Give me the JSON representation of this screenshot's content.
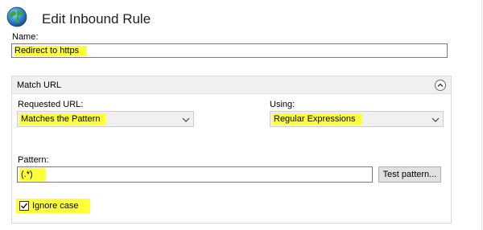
{
  "dialog": {
    "title": "Edit Inbound Rule",
    "icon": "globe-icon"
  },
  "name": {
    "label": "Name:",
    "value": "Redirect to https"
  },
  "match_url": {
    "section_title": "Match URL",
    "collapse_icon": "chevron-up-circle-icon",
    "requested_url": {
      "label": "Requested URL:",
      "selected": "Matches the Pattern"
    },
    "using": {
      "label": "Using:",
      "selected": "Regular Expressions"
    },
    "pattern": {
      "label": "Pattern:",
      "value": "(.*)"
    },
    "test_pattern_button": "Test pattern...",
    "ignore_case": {
      "label": "Ignore case",
      "checked": true
    }
  },
  "colors": {
    "highlight": "#ffff3a",
    "section_header_bg": "#f0f0f0",
    "dropdown_bg": "#f0f0f0"
  }
}
